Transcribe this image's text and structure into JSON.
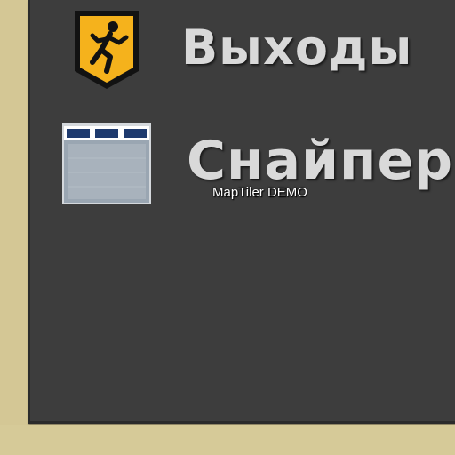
{
  "legend": {
    "items": [
      {
        "icon": "running-person-exit-icon",
        "label": "Выходы"
      },
      {
        "icon": "window-sniper-icon",
        "label": "Снайпер"
      }
    ]
  },
  "watermark": {
    "text": "MapTiler DEMO"
  },
  "colors": {
    "background": "#d4c795",
    "panel": "#3d3d3d",
    "label_text": "#d9d9d9",
    "exit_badge": "#f5b21c",
    "window_frame": "#1e3a6e",
    "window_glass": "#a8b2bc"
  }
}
